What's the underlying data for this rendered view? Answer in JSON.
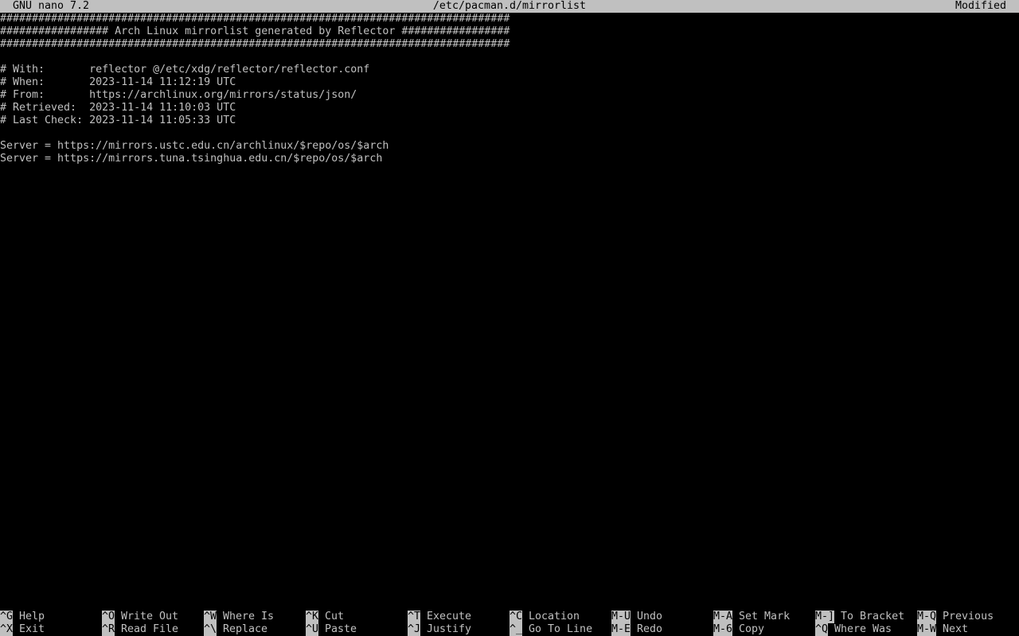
{
  "titlebar": {
    "version": "GNU nano 7.2",
    "filename": "/etc/pacman.d/mirrorlist",
    "status": "Modified"
  },
  "buffer": {
    "lines": [
      "################################################################################",
      "################# Arch Linux mirrorlist generated by Reflector #################",
      "################################################################################",
      "",
      "# With:       reflector @/etc/xdg/reflector/reflector.conf",
      "# When:       2023-11-14 11:12:19 UTC",
      "# From:       https://archlinux.org/mirrors/status/json/",
      "# Retrieved:  2023-11-14 11:10:03 UTC",
      "# Last Check: 2023-11-14 11:05:33 UTC",
      "",
      "Server = https://mirrors.ustc.edu.cn/archlinux/$repo/os/$arch",
      "Server = https://mirrors.tuna.tsinghua.edu.cn/$repo/os/$arch"
    ]
  },
  "shortcuts": {
    "row1": [
      {
        "key": "^G",
        "label": "Help"
      },
      {
        "key": "^O",
        "label": "Write Out"
      },
      {
        "key": "^W",
        "label": "Where Is"
      },
      {
        "key": "^K",
        "label": "Cut"
      },
      {
        "key": "^T",
        "label": "Execute"
      },
      {
        "key": "^C",
        "label": "Location"
      },
      {
        "key": "M-U",
        "label": "Undo"
      },
      {
        "key": "M-A",
        "label": "Set Mark"
      },
      {
        "key": "M-]",
        "label": "To Bracket"
      },
      {
        "key": "M-Q",
        "label": "Previous"
      }
    ],
    "row2": [
      {
        "key": "^X",
        "label": "Exit"
      },
      {
        "key": "^R",
        "label": "Read File"
      },
      {
        "key": "^\\",
        "label": "Replace"
      },
      {
        "key": "^U",
        "label": "Paste"
      },
      {
        "key": "^J",
        "label": "Justify"
      },
      {
        "key": "^_",
        "label": "Go To Line"
      },
      {
        "key": "M-E",
        "label": "Redo"
      },
      {
        "key": "M-6",
        "label": "Copy"
      },
      {
        "key": "^Q",
        "label": "Where Was"
      },
      {
        "key": "M-W",
        "label": "Next"
      }
    ]
  },
  "colors": {
    "background": "#000000",
    "foreground": "#c0c0c0",
    "inverse_bg": "#c0c0c0",
    "inverse_fg": "#000000"
  }
}
